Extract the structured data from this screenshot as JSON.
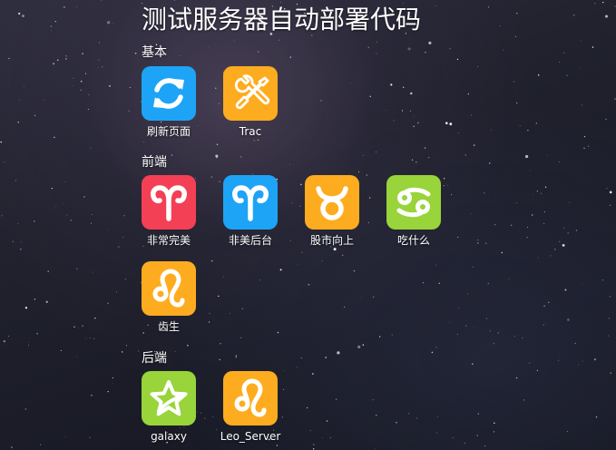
{
  "title": "测试服务器自动部署代码",
  "colors": {
    "blue": "#1ea4f6",
    "orange": "#fdac1f",
    "red": "#f44055",
    "green": "#98d43a"
  },
  "sections": {
    "basic": {
      "label": "基本",
      "items": [
        {
          "label": "刷新页面",
          "icon": "refresh-icon",
          "color": "#1ea4f6"
        },
        {
          "label": "Trac",
          "icon": "tools-icon",
          "color": "#fdac1f"
        }
      ]
    },
    "frontend": {
      "label": "前端",
      "items": [
        {
          "label": "非常完美",
          "icon": "aries-icon",
          "color": "#f44055"
        },
        {
          "label": "非美后台",
          "icon": "aries-icon",
          "color": "#1ea4f6"
        },
        {
          "label": "股市向上",
          "icon": "taurus-icon",
          "color": "#fdac1f"
        },
        {
          "label": "吃什么",
          "icon": "cancer-icon",
          "color": "#98d43a"
        },
        {
          "label": "齿生",
          "icon": "leo-icon",
          "color": "#fdac1f"
        }
      ]
    },
    "backend": {
      "label": "后端",
      "items": [
        {
          "label": "galaxy",
          "icon": "star-icon",
          "color": "#98d43a"
        },
        {
          "label": "Leo_Server",
          "icon": "leo-icon",
          "color": "#fdac1f"
        }
      ]
    }
  }
}
